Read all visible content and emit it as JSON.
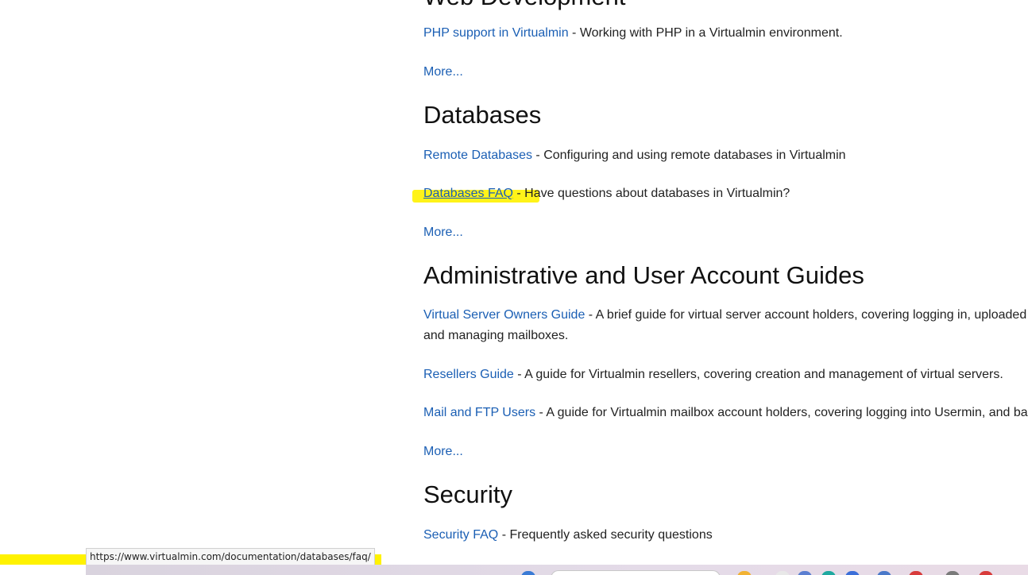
{
  "sections": {
    "web_dev": {
      "title": "Web Development",
      "entries": [
        {
          "link": "PHP support in Virtualmin",
          "desc": " - Working with PHP in a Virtualmin environment."
        }
      ],
      "more": "More..."
    },
    "databases": {
      "title": "Databases",
      "entries": [
        {
          "link": "Remote Databases",
          "desc": " - Configuring and using remote databases in Virtualmin"
        },
        {
          "link": "Databases FAQ",
          "desc_hl": " - Ha",
          "desc": "ve questions about databases in Virtualmin?"
        }
      ],
      "more": "More..."
    },
    "admin": {
      "title": "Administrative and User Account Guides",
      "entries": [
        {
          "link": "Virtual Server Owners Guide",
          "desc": " - A brief guide for virtual server account holders, covering logging in, uploaded and managing mailboxes."
        },
        {
          "link": "Resellers Guide",
          "desc": " - A guide for Virtualmin resellers, covering creation and management of virtual servers."
        },
        {
          "link": "Mail and FTP Users",
          "desc": " - A guide for Virtualmin mailbox account holders, covering logging into Usermin, and basic"
        }
      ],
      "more": "More..."
    },
    "security": {
      "title": "Security",
      "entries": [
        {
          "link": "Security FAQ",
          "desc": " - Frequently asked security questions"
        }
      ]
    }
  },
  "status_bar": {
    "url": "https://www.virtualmin.com/documentation/databases/faq/"
  },
  "colors": {
    "link": "#1b5fb4",
    "highlight": "#fff200"
  }
}
